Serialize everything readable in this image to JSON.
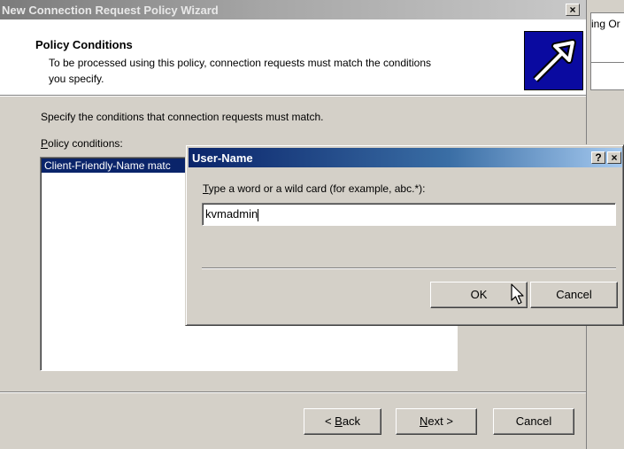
{
  "background_window": {
    "partial_text": "ing Or"
  },
  "wizard": {
    "title": "New Connection Request Policy Wizard",
    "close_glyph": "×",
    "header": {
      "title": "Policy Conditions",
      "subtitle_line1": "To be processed using this policy, connection requests must match the conditions",
      "subtitle_line2": "you specify."
    },
    "specify_text": "Specify the conditions that connection requests must match.",
    "conditions_label_accel": "P",
    "conditions_label_rest": "olicy conditions:",
    "conditions_list": [
      "Client-Friendly-Name matc"
    ],
    "buttons": {
      "back_pre": "< ",
      "back_accel": "B",
      "back_rest": "ack",
      "next_accel": "N",
      "next_rest": "ext >",
      "cancel": "Cancel"
    }
  },
  "dialog": {
    "title": "User-Name",
    "help_glyph": "?",
    "close_glyph": "×",
    "prompt_accel": "T",
    "prompt_rest": "ype a word or a wild card (for example, abc.*):",
    "input_value": "kvmadmin",
    "ok_label": "OK",
    "cancel_label": "Cancel"
  },
  "colors": {
    "dialog_title_active": "#0a246a",
    "wizard_title_inactive": "#7b7b7b",
    "selection": "#0a246a",
    "face": "#d4d0c8"
  }
}
